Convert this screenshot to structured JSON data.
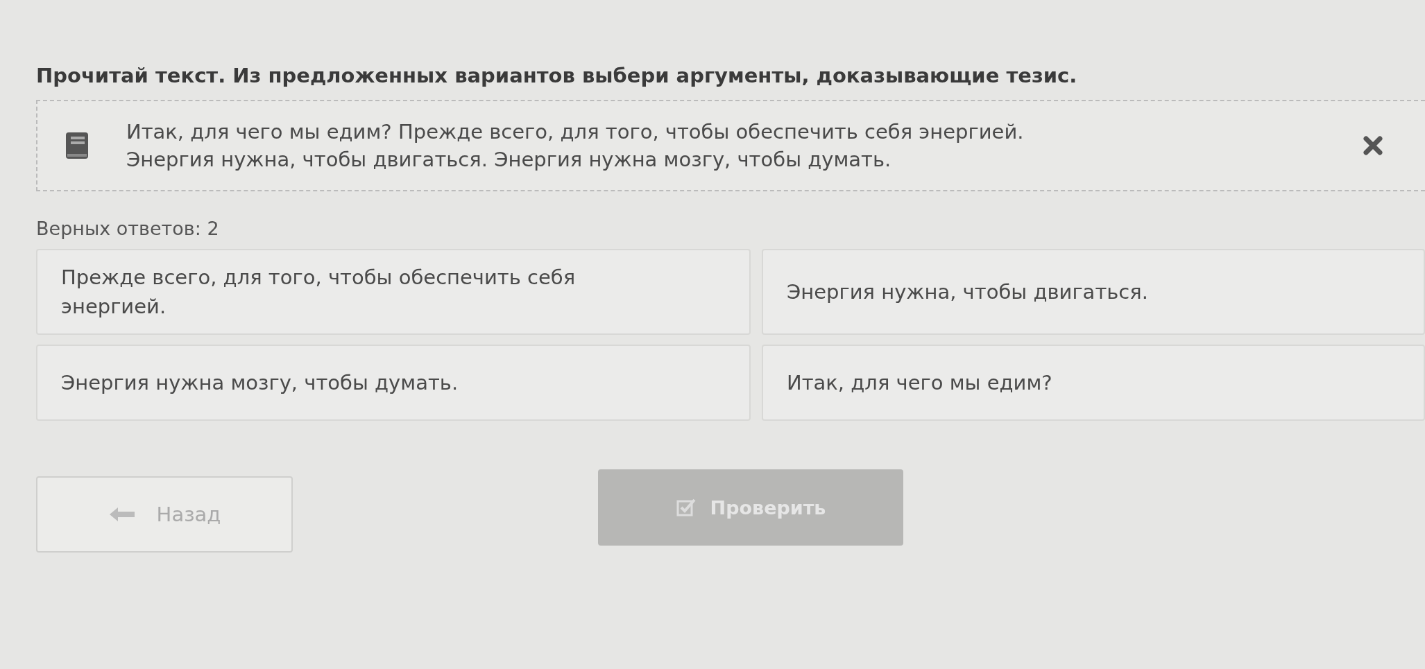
{
  "title": "Прочитай текст. Из предложенных вариантов выбери аргументы, доказывающие тезис.",
  "passage": {
    "text": "Итак, для чего мы едим? Прежде всего, для того, чтобы обеспечить себя энергией. Энергия нужна, чтобы двигаться. Энергия нужна мозгу, чтобы думать."
  },
  "answer_count": "Верных ответов: 2",
  "options": [
    {
      "text": "Прежде всего, для того, чтобы обеспечить себя энергией.",
      "selected": false
    },
    {
      "text": "Энергия нужна, чтобы двигаться.",
      "selected": false
    },
    {
      "text": "Энергия нужна мозгу, чтобы думать.",
      "selected": false
    },
    {
      "text": "Итак, для чего мы едим?",
      "selected": false
    }
  ],
  "back_button": {
    "label": "Назад"
  },
  "check_button": {
    "label": "Проверить",
    "disabled": true
  }
}
